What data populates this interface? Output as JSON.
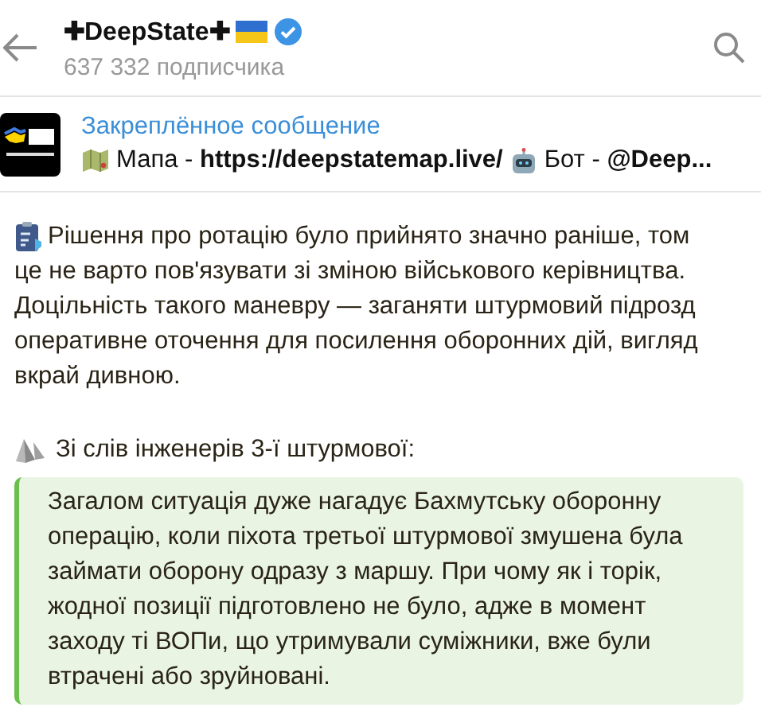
{
  "header": {
    "title": "✚DeepState✚",
    "verified": true,
    "subscribers": "637 332 подписчика"
  },
  "pinned": {
    "label": "Закреплённое сообщение",
    "map_text": "Мапа - **https://deepstatemap.live/**",
    "bot_text": "Бот - **@Deep...**"
  },
  "message": {
    "lines": [
      "Рішення про ротацію було прийнято значно раніше, том",
      "це не варто пов'язувати зі зміною військового керівництва.",
      "Доцільність такого маневру — заганяти штурмовий підрозд",
      "оперативне оточення для посилення оборонних дій, вигляд",
      "вкрай дивною."
    ],
    "quote_heading": "Зі слів інженерів 3-ї штурмової:",
    "quote_lines": [
      "Загалом ситуація дуже нагадує Бахмутську оборонну",
      "операцію, коли піхота третьої штурмової змушена була",
      "займати оборону одразу з маршу. При чому як і торік,",
      "жодної позиції підготовлено не було, адже в момент",
      "заходу ті ВОПи, що утримували суміжники, вже були",
      "втрачені або зруйновані."
    ]
  }
}
